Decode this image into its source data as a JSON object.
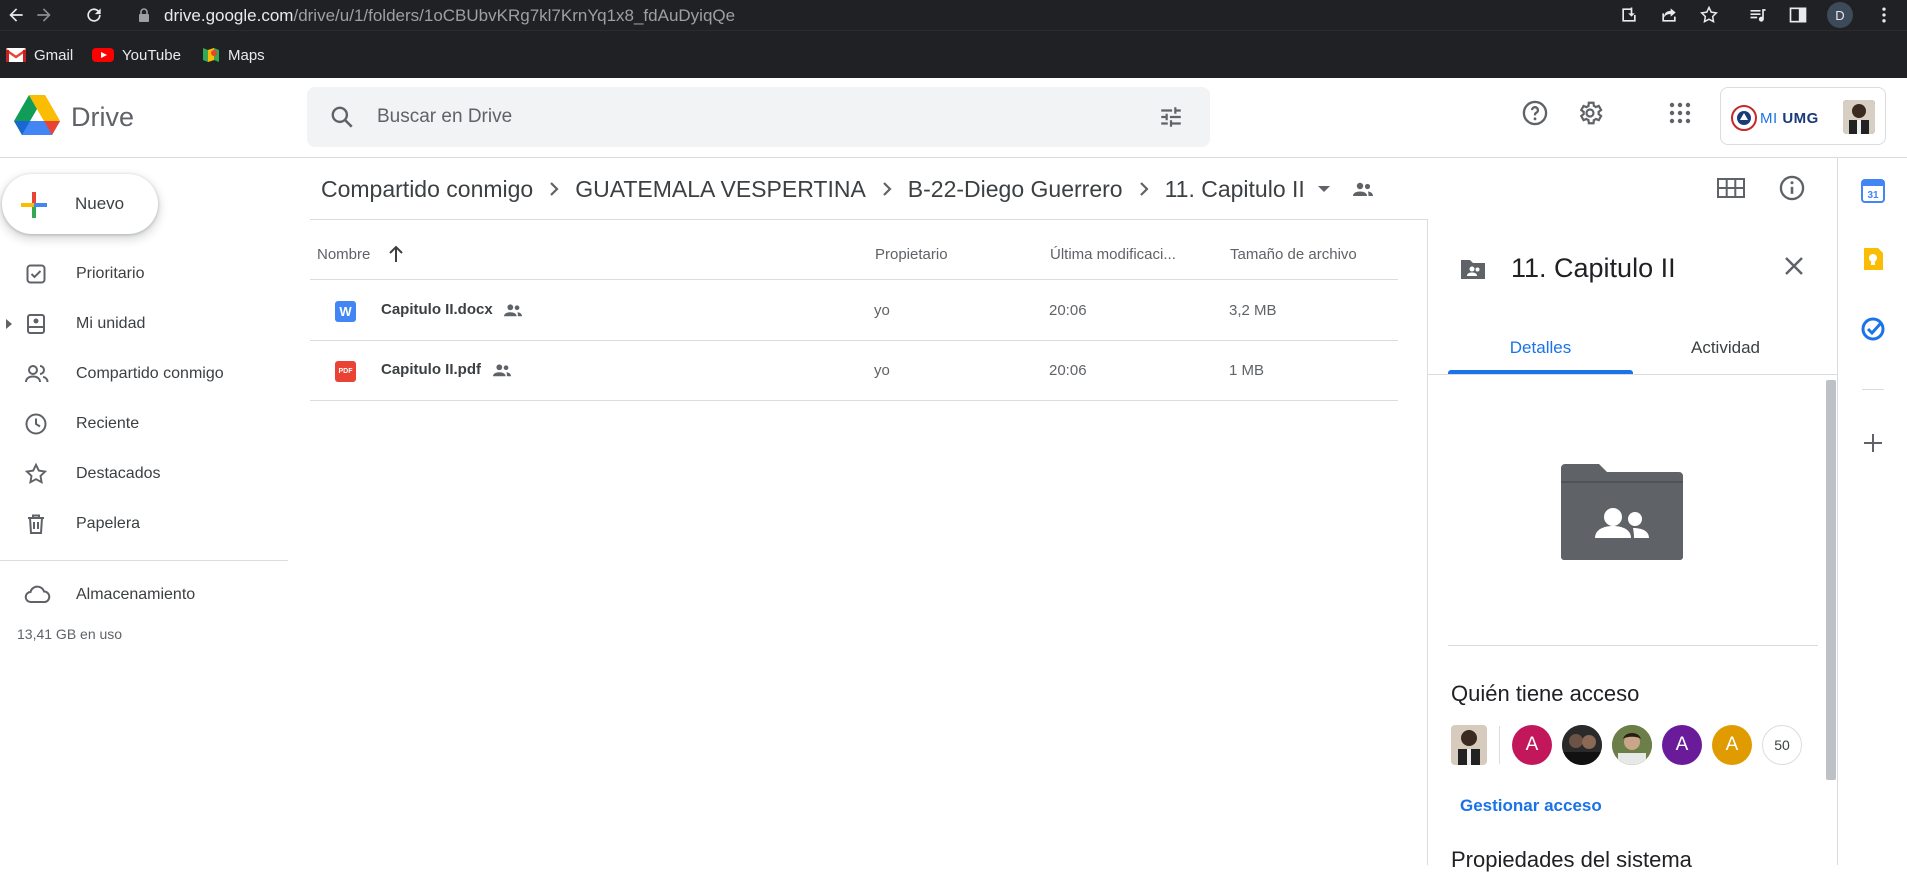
{
  "browser": {
    "url_host": "drive.google.com",
    "url_path": "/drive/u/1/folders/1oCBUbvKRg7kl7KrnYq1x8_fdAuDyiqQe",
    "profile_initial": "D",
    "bookmarks": [
      {
        "label": "Gmail",
        "icon": "gmail-icon"
      },
      {
        "label": "YouTube",
        "icon": "youtube-icon"
      },
      {
        "label": "Maps",
        "icon": "maps-icon"
      }
    ]
  },
  "header": {
    "app_title": "Drive",
    "search_placeholder": "Buscar en Drive",
    "account_org": {
      "mi": "MI",
      "umg": "UMG"
    }
  },
  "sidebar": {
    "new_label": "Nuevo",
    "items": [
      {
        "label": "Prioritario",
        "icon": "check-square-icon"
      },
      {
        "label": "Mi unidad",
        "icon": "my-drive-icon"
      },
      {
        "label": "Compartido conmigo",
        "icon": "people-icon"
      },
      {
        "label": "Reciente",
        "icon": "clock-icon"
      },
      {
        "label": "Destacados",
        "icon": "star-icon"
      },
      {
        "label": "Papelera",
        "icon": "trash-icon"
      }
    ],
    "storage_label": "Almacenamiento",
    "storage_used": "13,41 GB en uso"
  },
  "breadcrumb": [
    "Compartido conmigo",
    "GUATEMALA VESPERTINA",
    "B-22-Diego Guerrero",
    "11. Capitulo II"
  ],
  "file_list": {
    "columns": [
      "Nombre",
      "Propietario",
      "Última modificaci...",
      "Tamaño de archivo"
    ],
    "rows": [
      {
        "name": "Capitulo II.docx",
        "type": "docx",
        "icon_text": "W",
        "owner": "yo",
        "modified": "20:06",
        "size": "3,2 MB"
      },
      {
        "name": "Capitulo II.pdf",
        "type": "pdf",
        "icon_text": "PDF",
        "owner": "yo",
        "modified": "20:06",
        "size": "1 MB"
      }
    ]
  },
  "details": {
    "title": "11. Capitulo II",
    "tabs": [
      "Detalles",
      "Actividad"
    ],
    "access_title": "Quién tiene acceso",
    "avatars": [
      {
        "letter": "A",
        "color": "#c2185b"
      },
      {
        "letter": "",
        "color": "#3a3a3a"
      },
      {
        "letter": "",
        "color": "#5a6b3a"
      },
      {
        "letter": "A",
        "color": "#6a1b9a"
      },
      {
        "letter": "A",
        "color": "#e09b00"
      }
    ],
    "access_count": "50",
    "manage_label": "Gestionar acceso",
    "system_props": "Propiedades del sistema"
  },
  "colors": {
    "accent": "#1a73e8",
    "docx": "#4285f4",
    "pdf": "#ea4335"
  }
}
